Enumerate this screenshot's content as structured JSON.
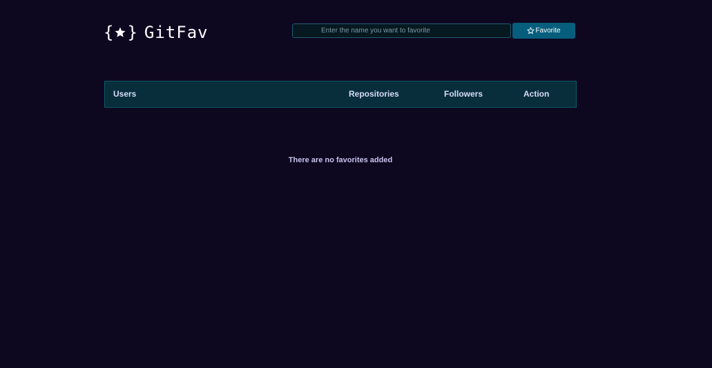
{
  "header": {
    "brand_name": "GitFav",
    "brand_icon": "curly-braces-star-icon",
    "search": {
      "placeholder": "Enter the name you want to favorite",
      "value": ""
    },
    "favorite_button": {
      "icon": "star-outline-icon",
      "label": "Favorite"
    }
  },
  "table": {
    "columns": [
      "Users",
      "Repositories",
      "Followers",
      "Action"
    ],
    "rows": [],
    "empty_message": "There are no favorites added"
  },
  "colors": {
    "background": "#0e0720",
    "table_header_bg": "#082e3c",
    "accent_button": "#065e7c",
    "header_text": "#d7dcf6"
  }
}
